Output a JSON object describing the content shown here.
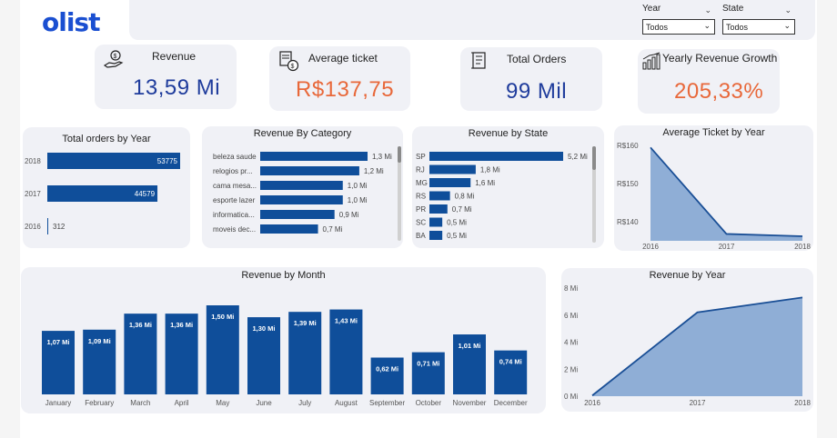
{
  "brand": {
    "logo": "olist"
  },
  "filters": [
    {
      "label": "Year",
      "value": "Todos"
    },
    {
      "label": "State",
      "value": "Todos"
    }
  ],
  "kpis": [
    {
      "title": "Revenue",
      "value": "13,59 Mi",
      "icon": "hand-money-icon"
    },
    {
      "title": "Average ticket",
      "value": "R$137,75",
      "icon": "receipt-money-icon"
    },
    {
      "title": "Total Orders",
      "value": "99 Mil",
      "icon": "document-list-icon"
    },
    {
      "title": "Yearly Revenue Growth",
      "value": "205,33%",
      "icon": "growth-chart-icon"
    }
  ],
  "colors": {
    "bar": "#0f4e9a",
    "area": "#8faed6",
    "area_line": "#1a4f96",
    "card": "#f0f1f6",
    "kpi_blue": "#1f3c9c",
    "kpi_orange": "#e8683a"
  },
  "chart_data": [
    {
      "id": "orders_by_year",
      "type": "bar",
      "title": "Total orders by Year",
      "categories": [
        "2018",
        "2017",
        "2016"
      ],
      "values": [
        53775,
        44579,
        312
      ],
      "labels": [
        "53775",
        "44579",
        "312"
      ]
    },
    {
      "id": "revenue_by_category",
      "type": "bar",
      "title": "Revenue By Category",
      "categories": [
        "beleza saude",
        "relogios pr...",
        "cama mesa...",
        "esporte lazer",
        "informatica...",
        "moveis dec..."
      ],
      "values": [
        1.3,
        1.2,
        1.0,
        1.0,
        0.9,
        0.7
      ],
      "labels": [
        "1,3 Mi",
        "1,2 Mi",
        "1,0 Mi",
        "1,0 Mi",
        "0,9 Mi",
        "0,7 Mi"
      ]
    },
    {
      "id": "revenue_by_state",
      "type": "bar",
      "title": "Revenue by State",
      "categories": [
        "SP",
        "RJ",
        "MG",
        "RS",
        "PR",
        "SC",
        "BA"
      ],
      "values": [
        5.2,
        1.8,
        1.6,
        0.8,
        0.7,
        0.5,
        0.5
      ],
      "labels": [
        "5,2 Mi",
        "1,8 Mi",
        "1,6 Mi",
        "0,8 Mi",
        "0,7 Mi",
        "0,5 Mi",
        "0,5 Mi"
      ]
    },
    {
      "id": "avg_ticket_by_year",
      "type": "area",
      "title": "Average Ticket by Year",
      "x": [
        "2016",
        "2017",
        "2018"
      ],
      "values": [
        159.5,
        136.8,
        136.2
      ],
      "yticks": [
        {
          "v": 140,
          "label": "R$140"
        },
        {
          "v": 150,
          "label": "R$150"
        },
        {
          "v": 160,
          "label": "R$160"
        }
      ],
      "ylim": [
        135,
        161
      ]
    },
    {
      "id": "revenue_by_month",
      "type": "bar",
      "title": "Revenue by Month",
      "categories": [
        "January",
        "February",
        "March",
        "April",
        "May",
        "June",
        "July",
        "August",
        "September",
        "October",
        "November",
        "December"
      ],
      "values": [
        1.07,
        1.09,
        1.36,
        1.36,
        1.5,
        1.3,
        1.39,
        1.43,
        0.62,
        0.71,
        1.01,
        0.74
      ],
      "labels": [
        "1,07 Mi",
        "1,09 Mi",
        "1,36 Mi",
        "1,36 Mi",
        "1,50 Mi",
        "1,30 Mi",
        "1,39 Mi",
        "1,43 Mi",
        "0,62 Mi",
        "0,71 Mi",
        "1,01 Mi",
        "0,74 Mi"
      ]
    },
    {
      "id": "revenue_by_year",
      "type": "area",
      "title": "Revenue by Year",
      "x": [
        "2016",
        "2017",
        "2018"
      ],
      "values": [
        0.05,
        6.2,
        7.3
      ],
      "yticks": [
        {
          "v": 0,
          "label": "0 Mi"
        },
        {
          "v": 2,
          "label": "2 Mi"
        },
        {
          "v": 4,
          "label": "4 Mi"
        },
        {
          "v": 6,
          "label": "6 Mi"
        },
        {
          "v": 8,
          "label": "8 Mi"
        }
      ],
      "ylim": [
        0,
        8
      ]
    }
  ]
}
